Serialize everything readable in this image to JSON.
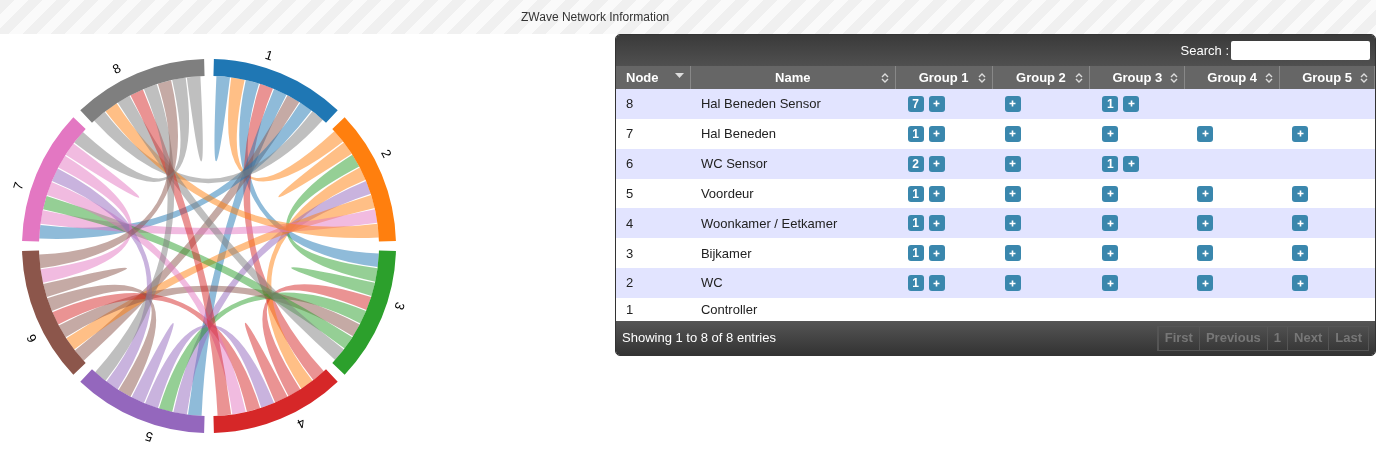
{
  "page_title": "ZWave Network Information",
  "chord_groups": [
    {
      "label": "1",
      "color": "#1f77b4"
    },
    {
      "label": "2",
      "color": "#ff7f0e"
    },
    {
      "label": "3",
      "color": "#2ca02c"
    },
    {
      "label": "4",
      "color": "#d62728"
    },
    {
      "label": "5",
      "color": "#9467bd"
    },
    {
      "label": "6",
      "color": "#8c564b"
    },
    {
      "label": "7",
      "color": "#e377c2"
    },
    {
      "label": "8",
      "color": "#7f7f7f"
    }
  ],
  "search": {
    "label": "Search :"
  },
  "columns": [
    {
      "label": "Node",
      "sorted": true
    },
    {
      "label": "Name",
      "sorted": false
    },
    {
      "label": "Group 1",
      "sorted": false
    },
    {
      "label": "Group 2",
      "sorted": false
    },
    {
      "label": "Group 3",
      "sorted": false
    },
    {
      "label": "Group 4",
      "sorted": false
    },
    {
      "label": "Group 5",
      "sorted": false
    }
  ],
  "rows": [
    {
      "node": "8",
      "name": "Hal Beneden Sensor",
      "groups": [
        {
          "count": "7",
          "add": true
        },
        {
          "add": true
        },
        {
          "count": "1",
          "add": true
        },
        {
          "add": false
        },
        {
          "add": false
        }
      ]
    },
    {
      "node": "7",
      "name": "Hal Beneden",
      "groups": [
        {
          "count": "1",
          "add": true
        },
        {
          "add": true
        },
        {
          "add": true
        },
        {
          "add": true
        },
        {
          "add": true
        }
      ]
    },
    {
      "node": "6",
      "name": "WC Sensor",
      "groups": [
        {
          "count": "2",
          "add": true
        },
        {
          "add": true
        },
        {
          "count": "1",
          "add": true
        },
        {
          "add": false
        },
        {
          "add": false
        }
      ]
    },
    {
      "node": "5",
      "name": "Voordeur",
      "groups": [
        {
          "count": "1",
          "add": true
        },
        {
          "add": true
        },
        {
          "add": true
        },
        {
          "add": true
        },
        {
          "add": true
        }
      ]
    },
    {
      "node": "4",
      "name": "Woonkamer / Eetkamer",
      "groups": [
        {
          "count": "1",
          "add": true
        },
        {
          "add": true
        },
        {
          "add": true
        },
        {
          "add": true
        },
        {
          "add": true
        }
      ]
    },
    {
      "node": "3",
      "name": "Bijkamer",
      "groups": [
        {
          "count": "1",
          "add": true
        },
        {
          "add": true
        },
        {
          "add": true
        },
        {
          "add": true
        },
        {
          "add": true
        }
      ]
    },
    {
      "node": "2",
      "name": "WC",
      "groups": [
        {
          "count": "1",
          "add": true
        },
        {
          "add": true
        },
        {
          "add": true
        },
        {
          "add": true
        },
        {
          "add": true
        }
      ]
    },
    {
      "node": "1",
      "name": "Controller",
      "groups": [
        {
          "add": false
        },
        {
          "add": false
        },
        {
          "add": false
        },
        {
          "add": false
        },
        {
          "add": false
        }
      ]
    }
  ],
  "info": "Showing 1 to 8 of 8 entries",
  "pagination": [
    {
      "label": "First",
      "disabled": true
    },
    {
      "label": "Previous",
      "disabled": true
    },
    {
      "label": "1",
      "disabled": true
    },
    {
      "label": "Next",
      "disabled": true
    },
    {
      "label": "Last",
      "disabled": true
    }
  ]
}
